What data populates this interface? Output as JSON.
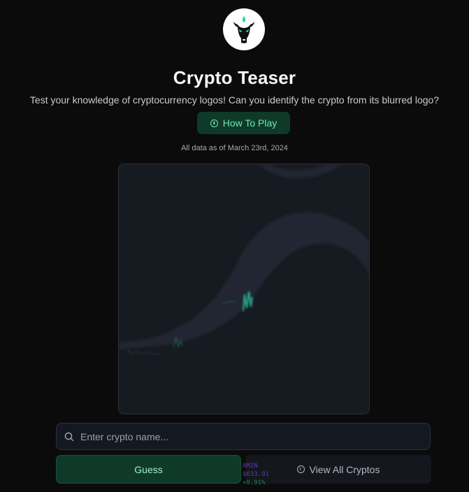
{
  "header": {
    "title": "Crypto Teaser",
    "subtitle": "Test your knowledge of cryptocurrency logos! Can you identify the crypto from its blurred logo?",
    "how_to_play_label": "How To Play",
    "data_date_text": "All data as of March 23rd, 2024"
  },
  "logo": {
    "icon": "bull-head-icon",
    "accent_color": "#2dd4a8"
  },
  "search": {
    "placeholder": "Enter crypto name...",
    "value": ""
  },
  "actions": {
    "guess_label": "Guess",
    "view_all_label": "View All Cryptos"
  },
  "ticker": {
    "symbol": "AMZN",
    "price": "$633.91",
    "change": "+0.91%"
  },
  "colors": {
    "background": "#0b0b0c",
    "accent_green": "#0f3a2a",
    "accent_green_text": "#6ee7b7",
    "card_background": "#161a21"
  }
}
